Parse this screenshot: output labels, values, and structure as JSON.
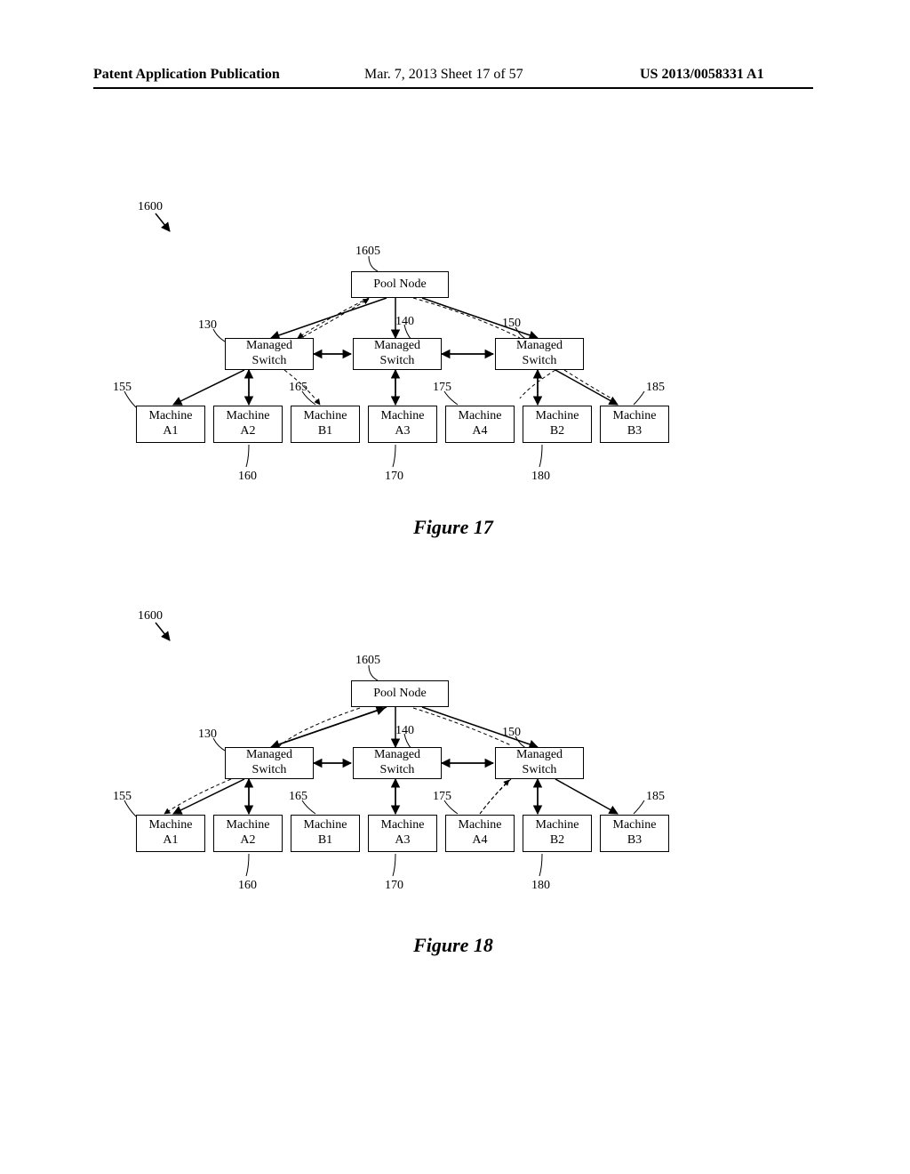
{
  "header": {
    "left": "Patent Application Publication",
    "mid": "Mar. 7, 2013  Sheet 17 of 57",
    "right": "US 2013/0058331 A1"
  },
  "figures": [
    {
      "caption": "Figure 17",
      "systemLabel": "1600",
      "pool": {
        "label": "Pool Node",
        "ref": "1605"
      },
      "switches": [
        {
          "label": "Managed\nSwitch",
          "ref": "130"
        },
        {
          "label": "Managed\nSwitch",
          "ref": "140"
        },
        {
          "label": "Managed\nSwitch",
          "ref": "150"
        }
      ],
      "machines": [
        {
          "label": "Machine\nA1",
          "ref": "155"
        },
        {
          "label": "Machine\nA2",
          "ref": "160"
        },
        {
          "label": "Machine\nB1",
          "ref": "165"
        },
        {
          "label": "Machine\nA3",
          "ref": "170"
        },
        {
          "label": "Machine\nA4",
          "ref": "175"
        },
        {
          "label": "Machine\nB2",
          "ref": "180"
        },
        {
          "label": "Machine\nB3",
          "ref": "185"
        }
      ]
    },
    {
      "caption": "Figure 18",
      "systemLabel": "1600",
      "pool": {
        "label": "Pool Node",
        "ref": "1605"
      },
      "switches": [
        {
          "label": "Managed\nSwitch",
          "ref": "130"
        },
        {
          "label": "Managed\nSwitch",
          "ref": "140"
        },
        {
          "label": "Managed\nSwitch",
          "ref": "150"
        }
      ],
      "machines": [
        {
          "label": "Machine\nA1",
          "ref": "155"
        },
        {
          "label": "Machine\nA2",
          "ref": "160"
        },
        {
          "label": "Machine\nB1",
          "ref": "165"
        },
        {
          "label": "Machine\nA3",
          "ref": "170"
        },
        {
          "label": "Machine\nA4",
          "ref": "175"
        },
        {
          "label": "Machine\nB2",
          "ref": "180"
        },
        {
          "label": "Machine\nB3",
          "ref": "185"
        }
      ]
    }
  ]
}
